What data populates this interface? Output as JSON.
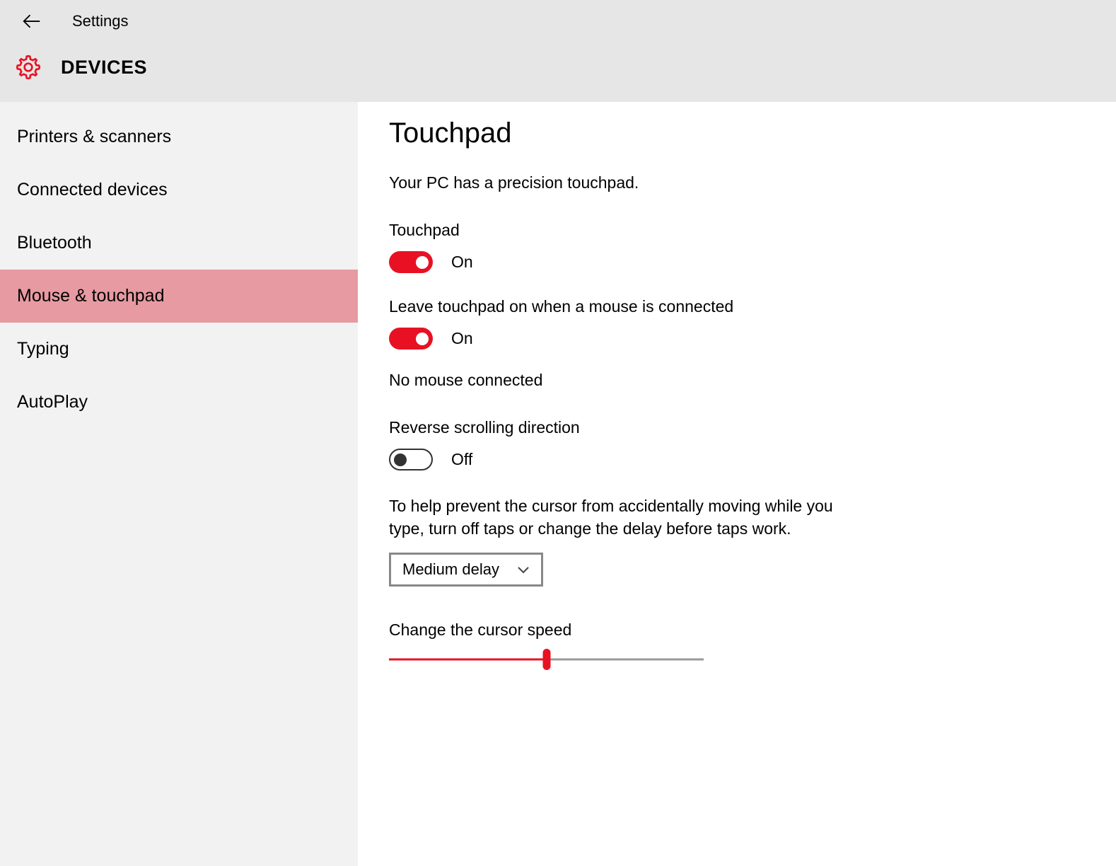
{
  "accent": "#e81123",
  "selected_bg": "#e79aa2",
  "header": {
    "app_title": "Settings",
    "category": "DEVICES"
  },
  "sidebar": {
    "items": [
      {
        "label": "Printers & scanners",
        "selected": false
      },
      {
        "label": "Connected devices",
        "selected": false
      },
      {
        "label": "Bluetooth",
        "selected": false
      },
      {
        "label": "Mouse & touchpad",
        "selected": true
      },
      {
        "label": "Typing",
        "selected": false
      },
      {
        "label": "AutoPlay",
        "selected": false
      }
    ]
  },
  "content": {
    "heading": "Touchpad",
    "intro": "Your PC has a precision touchpad.",
    "toggles": {
      "touchpad": {
        "label": "Touchpad",
        "state_label": "On",
        "on": true
      },
      "leave_on_mouse": {
        "label": "Leave touchpad on when a mouse is connected",
        "state_label": "On",
        "on": true
      },
      "mouse_status": "No mouse connected",
      "reverse_scroll": {
        "label": "Reverse scrolling direction",
        "state_label": "Off",
        "on": false
      }
    },
    "tap_delay": {
      "help": "To help prevent the cursor from accidentally moving while you type, turn off taps or change the delay before taps work.",
      "selected": "Medium delay"
    },
    "cursor_speed": {
      "label": "Change the cursor speed",
      "value_percent": 50
    }
  }
}
